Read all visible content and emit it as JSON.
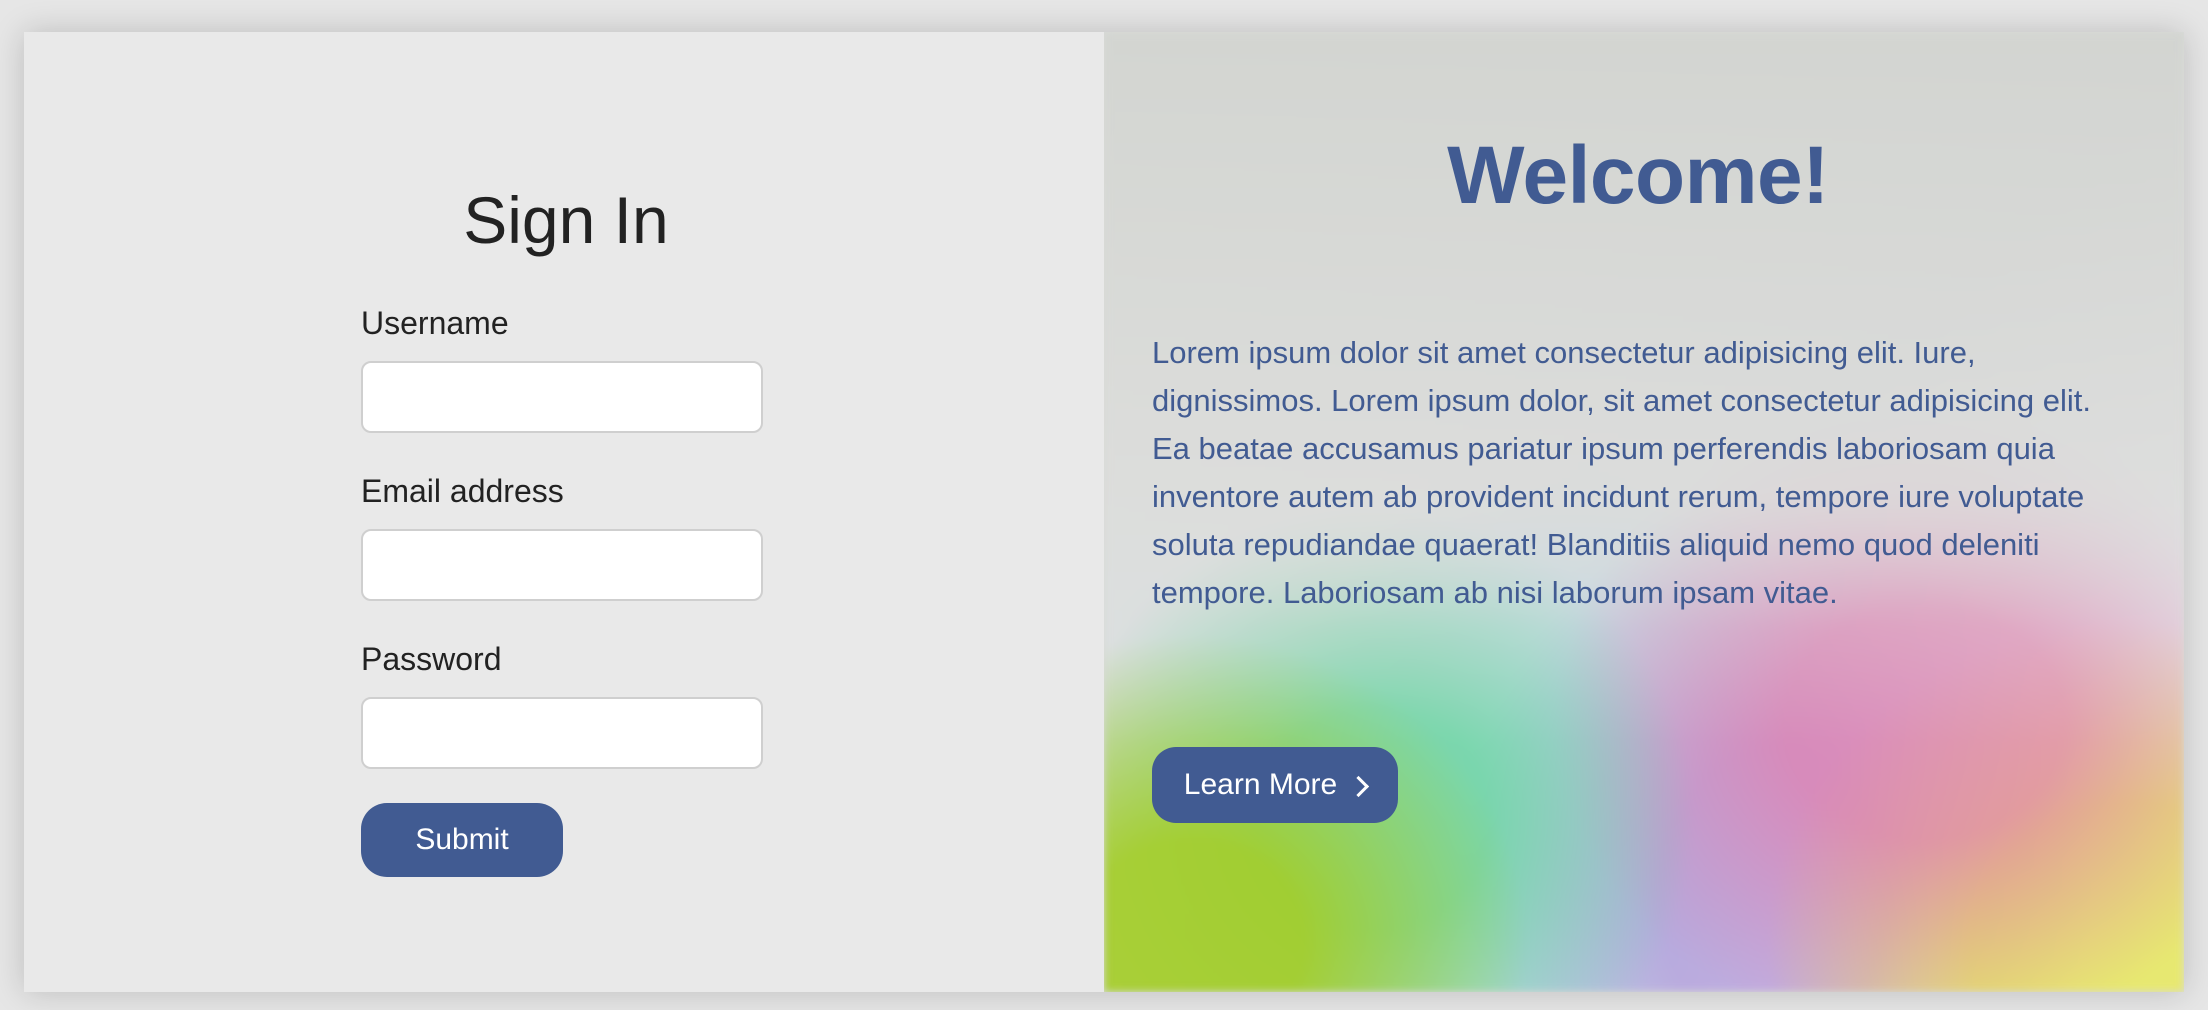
{
  "signin": {
    "title": "Sign In",
    "username_label": "Username",
    "email_label": "Email address",
    "password_label": "Password",
    "submit_label": "Submit"
  },
  "welcome": {
    "title": "Welcome!",
    "body": "Lorem ipsum dolor sit amet consectetur adipisicing elit. Iure, dignissimos. Lorem ipsum dolor, sit amet consectetur adipisicing elit. Ea beatae accusamus pariatur ipsum perferendis laboriosam quia inventore autem ab provident incidunt rerum, tempore iure voluptate soluta repudiandae quaerat! Blanditiis aliquid nemo quod deleniti tempore. Laboriosam ab nisi laborum ipsam vitae.",
    "learn_more_label": "Learn More"
  },
  "colors": {
    "accent": "#415b92",
    "panel_left": "#e9e9e9"
  },
  "icons": {
    "learn_more": "chevron-right-icon"
  }
}
